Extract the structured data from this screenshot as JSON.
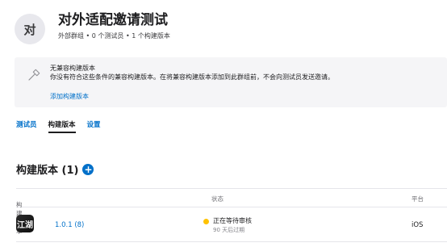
{
  "header": {
    "avatar_text": "对",
    "title": "对外适配邀请测试",
    "subtitle": "外部群组 • 0 个测试员 • 1 个构建版本"
  },
  "notice": {
    "icon": "hammer-icon",
    "title": "无兼容构建版本",
    "description": "你没有符合这些条件的兼容构建版本。在将兼容构建版本添加到此群组前，不会向测试员发送邀请。",
    "link": "添加构建版本"
  },
  "tabs": [
    {
      "label": "测试员",
      "active": false
    },
    {
      "label": "构建版本",
      "active": true
    },
    {
      "label": "设置",
      "active": false
    }
  ],
  "section": {
    "title": "构建版本 (1)",
    "add_icon": "plus-circle-icon"
  },
  "table": {
    "columns": {
      "build": "构建版本",
      "status": "状态",
      "platform": "平台"
    },
    "rows": [
      {
        "icon_text": "江湖",
        "version": "1.0.1 (8)",
        "status": "正在等待审核",
        "status_sub": "90 天后过期",
        "status_color": "#ffc200",
        "platform": "iOS"
      }
    ]
  },
  "colors": {
    "accent": "#0070c9",
    "pending": "#ffc200"
  }
}
